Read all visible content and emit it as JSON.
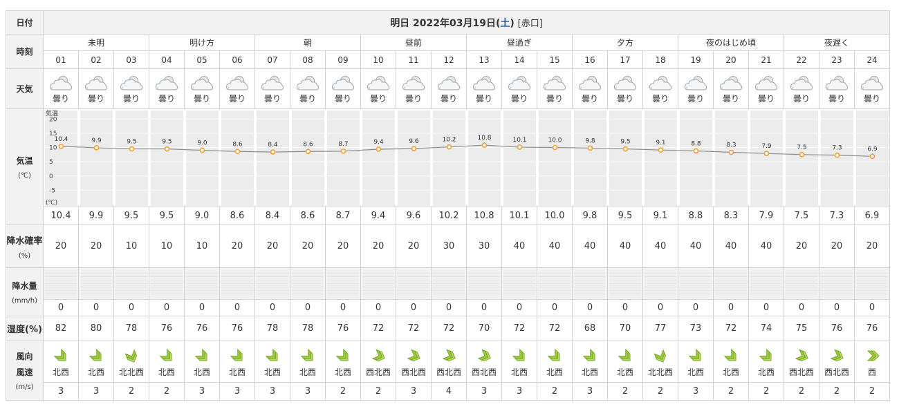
{
  "labels": {
    "date": "日付",
    "time": "時刻",
    "weather": "天気",
    "temp": "気温",
    "temp_unit": "(℃)",
    "rain_prob": "降水確率",
    "rain_prob_unit": "(%)",
    "rain_amount": "降水量",
    "rain_amount_unit": "(mm/h)",
    "humidity": "湿度(%)",
    "wind_dir": "風向",
    "wind_speed": "風速",
    "wind_unit": "(m/s)"
  },
  "date": {
    "prefix": "明日 2022年03月19日(",
    "weekday": "土",
    "suffix": ")",
    "place": "[赤口]"
  },
  "periods": [
    "未明",
    "明け方",
    "朝",
    "昼前",
    "昼過ぎ",
    "夕方",
    "夜のはじめ頃",
    "夜遅く"
  ],
  "hours": [
    "01",
    "02",
    "03",
    "04",
    "05",
    "06",
    "07",
    "08",
    "09",
    "10",
    "11",
    "12",
    "13",
    "14",
    "15",
    "16",
    "17",
    "18",
    "19",
    "20",
    "21",
    "22",
    "23",
    "24"
  ],
  "weather": [
    "曇り",
    "曇り",
    "曇り",
    "曇り",
    "曇り",
    "曇り",
    "曇り",
    "曇り",
    "曇り",
    "曇り",
    "曇り",
    "曇り",
    "曇り",
    "曇り",
    "曇り",
    "曇り",
    "曇り",
    "曇り",
    "曇り",
    "曇り",
    "曇り",
    "曇り",
    "曇り",
    "曇り"
  ],
  "temps": [
    "10.4",
    "9.9",
    "9.5",
    "9.5",
    "9.0",
    "8.6",
    "8.4",
    "8.6",
    "8.7",
    "9.4",
    "9.6",
    "10.2",
    "10.8",
    "10.1",
    "10.0",
    "9.8",
    "9.5",
    "9.1",
    "8.8",
    "8.3",
    "7.9",
    "7.5",
    "7.3",
    "6.9"
  ],
  "rain_prob": [
    "20",
    "20",
    "10",
    "10",
    "10",
    "20",
    "20",
    "20",
    "20",
    "20",
    "20",
    "30",
    "30",
    "40",
    "40",
    "40",
    "40",
    "40",
    "40",
    "40",
    "40",
    "20",
    "20",
    "20"
  ],
  "rain_amount": [
    "0",
    "0",
    "0",
    "0",
    "0",
    "0",
    "0",
    "0",
    "0",
    "0",
    "0",
    "0",
    "0",
    "0",
    "0",
    "0",
    "0",
    "0",
    "0",
    "0",
    "0",
    "0",
    "0",
    "0"
  ],
  "humidity": [
    "82",
    "80",
    "78",
    "76",
    "76",
    "76",
    "78",
    "78",
    "76",
    "72",
    "72",
    "72",
    "70",
    "72",
    "72",
    "68",
    "70",
    "77",
    "73",
    "72",
    "74",
    "75",
    "76",
    "76"
  ],
  "wind_dir": [
    "北西",
    "北西",
    "北北西",
    "北西",
    "北西",
    "北西",
    "北西",
    "北西",
    "北西",
    "西北西",
    "西北西",
    "西北西",
    "西北西",
    "北西",
    "北西",
    "北西",
    "北西",
    "北北西",
    "北西",
    "北西",
    "北西",
    "西北西",
    "西北西",
    "西"
  ],
  "wind_speed": [
    "3",
    "3",
    "2",
    "2",
    "3",
    "3",
    "3",
    "3",
    "2",
    "2",
    "3",
    "4",
    "3",
    "3",
    "2",
    "3",
    "2",
    "2",
    "3",
    "2",
    "2",
    "2",
    "2",
    "2"
  ],
  "chart_data": {
    "type": "line",
    "x": [
      "01",
      "02",
      "03",
      "04",
      "05",
      "06",
      "07",
      "08",
      "09",
      "10",
      "11",
      "12",
      "13",
      "14",
      "15",
      "16",
      "17",
      "18",
      "19",
      "20",
      "21",
      "22",
      "23",
      "24"
    ],
    "values": [
      10.4,
      9.9,
      9.5,
      9.5,
      9.0,
      8.6,
      8.4,
      8.6,
      8.7,
      9.4,
      9.6,
      10.2,
      10.8,
      10.1,
      10.0,
      9.8,
      9.5,
      9.1,
      8.8,
      8.3,
      7.9,
      7.5,
      7.3,
      6.9
    ],
    "ylabel": "気温",
    "yunit": "(℃)",
    "yticks": [
      "20",
      "15",
      "10",
      "5",
      "0",
      "-5"
    ],
    "ylim": [
      -10,
      22
    ],
    "line_color": "#8c8c8c",
    "marker_color": "#f0a030"
  }
}
